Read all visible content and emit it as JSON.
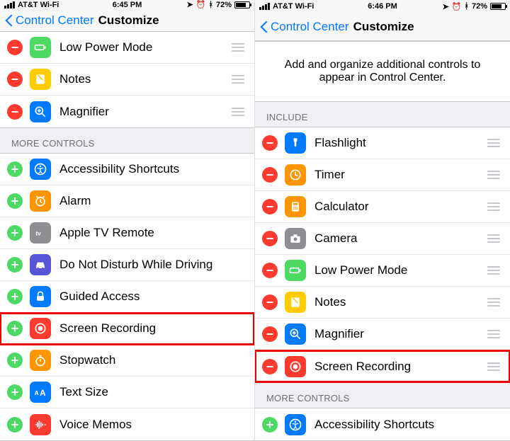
{
  "left": {
    "status": {
      "carrier": "AT&T Wi-Fi",
      "time": "6:45 PM",
      "battery_pct": "72%"
    },
    "nav": {
      "back_label": "Control Center",
      "title": "Customize"
    },
    "included_tail": [
      {
        "key": "lowpower",
        "label": "Low Power Mode",
        "icon": "lowpower-icon",
        "color": "ic-lowpower"
      },
      {
        "key": "notes",
        "label": "Notes",
        "icon": "notes-icon",
        "color": "ic-notes"
      },
      {
        "key": "magnifier",
        "label": "Magnifier",
        "icon": "magnifier-icon",
        "color": "ic-magnifier"
      }
    ],
    "more_header": "MORE CONTROLS",
    "more": [
      {
        "key": "accessibility",
        "label": "Accessibility Shortcuts",
        "icon": "accessibility-icon",
        "color": "ic-accessibility"
      },
      {
        "key": "alarm",
        "label": "Alarm",
        "icon": "alarm-icon",
        "color": "ic-alarm"
      },
      {
        "key": "appletv",
        "label": "Apple TV Remote",
        "icon": "appletv-icon",
        "color": "ic-appletv"
      },
      {
        "key": "dnd-driving",
        "label": "Do Not Disturb While Driving",
        "icon": "car-icon",
        "color": "ic-dnd"
      },
      {
        "key": "guided",
        "label": "Guided Access",
        "icon": "lock-icon",
        "color": "ic-guided"
      },
      {
        "key": "screenrec",
        "label": "Screen Recording",
        "icon": "record-icon",
        "color": "ic-screenrec",
        "highlight": true
      },
      {
        "key": "stopwatch",
        "label": "Stopwatch",
        "icon": "stopwatch-icon",
        "color": "ic-stopwatch"
      },
      {
        "key": "textsize",
        "label": "Text Size",
        "icon": "textsize-icon",
        "color": "ic-textsize"
      },
      {
        "key": "voicememos",
        "label": "Voice Memos",
        "icon": "waveform-icon",
        "color": "ic-voicememos"
      }
    ]
  },
  "right": {
    "status": {
      "carrier": "AT&T Wi-Fi",
      "time": "6:46 PM",
      "battery_pct": "72%"
    },
    "nav": {
      "back_label": "Control Center",
      "title": "Customize"
    },
    "intro": "Add and organize additional controls to appear in Control Center.",
    "include_header": "INCLUDE",
    "included": [
      {
        "key": "flashlight",
        "label": "Flashlight",
        "icon": "flashlight-icon",
        "color": "ic-flashlight"
      },
      {
        "key": "timer",
        "label": "Timer",
        "icon": "timer-icon",
        "color": "ic-timer"
      },
      {
        "key": "calculator",
        "label": "Calculator",
        "icon": "calculator-icon",
        "color": "ic-calculator"
      },
      {
        "key": "camera",
        "label": "Camera",
        "icon": "camera-icon",
        "color": "ic-camera"
      },
      {
        "key": "lowpower",
        "label": "Low Power Mode",
        "icon": "lowpower-icon",
        "color": "ic-lowpower"
      },
      {
        "key": "notes",
        "label": "Notes",
        "icon": "notes-icon",
        "color": "ic-notes"
      },
      {
        "key": "magnifier",
        "label": "Magnifier",
        "icon": "magnifier-icon",
        "color": "ic-magnifier"
      },
      {
        "key": "screenrec",
        "label": "Screen Recording",
        "icon": "record-icon",
        "color": "ic-screenrec",
        "highlight": true
      }
    ],
    "more_header": "MORE CONTROLS",
    "more": [
      {
        "key": "accessibility",
        "label": "Accessibility Shortcuts",
        "icon": "accessibility-icon",
        "color": "ic-accessibility"
      }
    ]
  },
  "glyphs": {
    "lowpower-icon": "<svg viewBox='0 0 24 24'><rect x='3' y='8' width='15' height='8' rx='2' fill='none' stroke='#fff' stroke-width='2'/><rect x='19' y='10' width='2' height='4' fill='#fff'/></svg>",
    "notes-icon": "<svg viewBox='0 0 24 24'><rect x='5' y='4' width='14' height='16' rx='2' fill='#fff'/><path d='M8 5l8 8' stroke='#ffcc00' stroke-width='2'/></svg>",
    "magnifier-icon": "<svg viewBox='0 0 24 24'><circle cx='10' cy='10' r='6' fill='none' stroke='#fff' stroke-width='2'/><line x1='15' y1='15' x2='20' y2='20' stroke='#fff' stroke-width='2'/><line x1='10' y1='7' x2='10' y2='13' stroke='#fff' stroke-width='2'/><line x1='7' y1='10' x2='13' y2='10' stroke='#fff' stroke-width='2'/></svg>",
    "accessibility-icon": "<svg viewBox='0 0 24 24'><circle cx='12' cy='12' r='9' fill='none' stroke='#fff' stroke-width='2'/><circle cx='12' cy='7' r='1.5' fill='#fff'/><path d='M7 10l5 1 5-1M12 11v5m-3 3l3-3 3 3' stroke='#fff' stroke-width='1.5' fill='none'/></svg>",
    "alarm-icon": "<svg viewBox='0 0 24 24'><circle cx='12' cy='13' r='7' fill='none' stroke='#fff' stroke-width='2'/><path d='M12 9v4l3 2M5 4l3 2M19 4l-3 2' stroke='#fff' stroke-width='2' fill='none'/></svg>",
    "appletv-icon": "<svg viewBox='0 0 24 24'><text x='4' y='16' font-size='10' fill='#fff' font-weight='bold'>tv</text></svg>",
    "car-icon": "<svg viewBox='0 0 24 24'><path d='M5 14l2-6h10l2 6v4H5z' fill='#fff'/><circle cx='8' cy='18' r='1.5' fill='#5856d6'/><circle cx='16' cy='18' r='1.5' fill='#5856d6'/></svg>",
    "lock-icon": "<svg viewBox='0 0 24 24'><rect x='6' y='11' width='12' height='8' rx='2' fill='#fff'/><path d='M8 11V8a4 4 0 018 0v3' stroke='#fff' stroke-width='2' fill='none'/></svg>",
    "record-icon": "<svg viewBox='0 0 24 24'><circle cx='12' cy='12' r='8' fill='none' stroke='#fff' stroke-width='2'/><circle cx='12' cy='12' r='4' fill='#fff'/></svg>",
    "stopwatch-icon": "<svg viewBox='0 0 24 24'><circle cx='12' cy='14' r='7' fill='none' stroke='#fff' stroke-width='2'/><path d='M12 10v4M10 4h4M12 4v3' stroke='#fff' stroke-width='2'/></svg>",
    "textsize-icon": "<svg viewBox='0 0 24 24'><text x='2' y='17' font-size='10' fill='#fff' font-weight='bold'>A</text><text x='11' y='18' font-size='14' fill='#fff' font-weight='bold'>A</text></svg>",
    "waveform-icon": "<svg viewBox='0 0 24 24'><path d='M4 12h2M7 8v8M10 5v14M13 8v8M16 10v4M19 12h2' stroke='#fff' stroke-width='2'/></svg>",
    "flashlight-icon": "<svg viewBox='0 0 24 24'><path d='M9 4h6v4l-1.5 3v7h-3v-7L9 8z' fill='#fff'/></svg>",
    "timer-icon": "<svg viewBox='0 0 24 24'><circle cx='12' cy='12' r='8' fill='none' stroke='#fff' stroke-width='2'/><path d='M12 7v5l4 2' stroke='#fff' stroke-width='2' fill='none'/></svg>",
    "calculator-icon": "<svg viewBox='0 0 24 24'><rect x='6' y='4' width='12' height='16' rx='2' fill='#fff'/><rect x='8' y='6' width='8' height='3' fill='#ff9500'/><circle cx='9' cy='13' r='1' fill='#ff9500'/><circle cx='12' cy='13' r='1' fill='#ff9500'/><circle cx='15' cy='13' r='1' fill='#ff9500'/><circle cx='9' cy='16' r='1' fill='#ff9500'/><circle cx='12' cy='16' r='1' fill='#ff9500'/><circle cx='15' cy='16' r='1' fill='#ff9500'/></svg>",
    "camera-icon": "<svg viewBox='0 0 24 24'><rect x='4' y='8' width='16' height='11' rx='2' fill='#fff'/><circle cx='12' cy='13' r='3' fill='#8e8e93'/><rect x='9' y='5' width='6' height='4' rx='1' fill='#fff'/></svg>"
  }
}
